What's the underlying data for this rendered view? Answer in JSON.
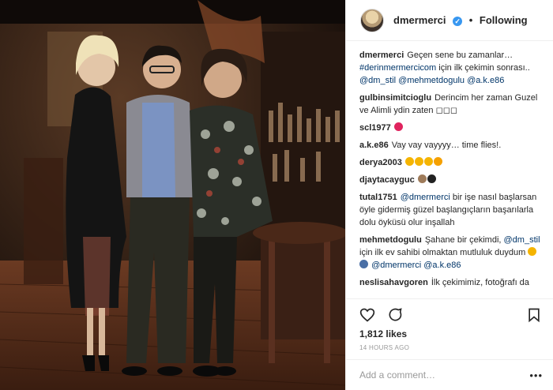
{
  "post": {
    "username": "dmermerci",
    "verified_mark": "✓",
    "separator": "•",
    "follow_label": "Following",
    "icons": {
      "avatar": "avatar",
      "verified": "verified-badge-icon",
      "like": "heart-icon",
      "comment": "comment-icon",
      "save": "bookmark-icon",
      "more": "more-options-icon"
    },
    "accent_color": "#3897f0",
    "link_color": "#003569"
  },
  "comments": [
    {
      "user": "dmermerci",
      "parts": [
        {
          "t": "Geçen sene bu zamanlar… "
        },
        {
          "t": "#derinmermercicom",
          "link": true
        },
        {
          "t": " için ilk çekimin sonrası.. "
        },
        {
          "t": "@dm_stil",
          "link": true
        },
        {
          "t": " "
        },
        {
          "t": "@mehmetdogulu",
          "link": true
        },
        {
          "t": " "
        },
        {
          "t": "@a.k.e86",
          "link": true
        }
      ]
    },
    {
      "user": "gulbinsimitcioglu",
      "parts": [
        {
          "t": "Derincim her zaman Guzel ve Alimli ydin zaten ◻◻◻"
        }
      ]
    },
    {
      "user": "scl1977",
      "parts": [
        {
          "emoji": "kiss",
          "color": "#e0245e"
        }
      ]
    },
    {
      "user": "a.k.e86",
      "parts": [
        {
          "t": "Vay vay vayyyy… time flies!."
        }
      ]
    },
    {
      "user": "derya2003",
      "parts": [
        {
          "emoji": "smile",
          "color": "#f5b400"
        },
        {
          "emoji": "smile",
          "color": "#f5b400"
        },
        {
          "emoji": "smile",
          "color": "#f5b400"
        },
        {
          "emoji": "heart-eyes",
          "color": "#f5a000"
        }
      ]
    },
    {
      "user": "djaytacayguc",
      "parts": [
        {
          "emoji": "owl",
          "color": "#9e7b5a"
        },
        {
          "emoji": "sunglasses",
          "color": "#222222"
        }
      ]
    },
    {
      "user": "tutal1751",
      "parts": [
        {
          "t": "@dmermerci",
          "link": true
        },
        {
          "t": " bir işe nasıl başlarsan öyle gidermiş güzel başlangıçların başarılarla dolu öyküsü olur inşallah"
        }
      ]
    },
    {
      "user": "mehmetdogulu",
      "parts": [
        {
          "t": "Şahane bir çekimdi, "
        },
        {
          "t": "@dm_stil",
          "link": true
        },
        {
          "t": " için ilk ev sahibi olmaktan mutluluk duydum "
        },
        {
          "emoji": "smile",
          "color": "#f5b400"
        },
        {
          "emoji": "person",
          "color": "#4a6fa5"
        },
        {
          "t": " "
        },
        {
          "t": "@dmermerci",
          "link": true
        },
        {
          "t": " "
        },
        {
          "t": "@a.k.e86",
          "link": true
        }
      ]
    },
    {
      "user": "neslisahavgoren",
      "parts": [
        {
          "t": "İlk çekimimiz, fotoğrafı da"
        }
      ]
    }
  ],
  "likes_text": "1,812 likes",
  "timestamp": "14 HOURS AGO",
  "add_comment_placeholder": "Add a comment…",
  "more_options": "•••"
}
